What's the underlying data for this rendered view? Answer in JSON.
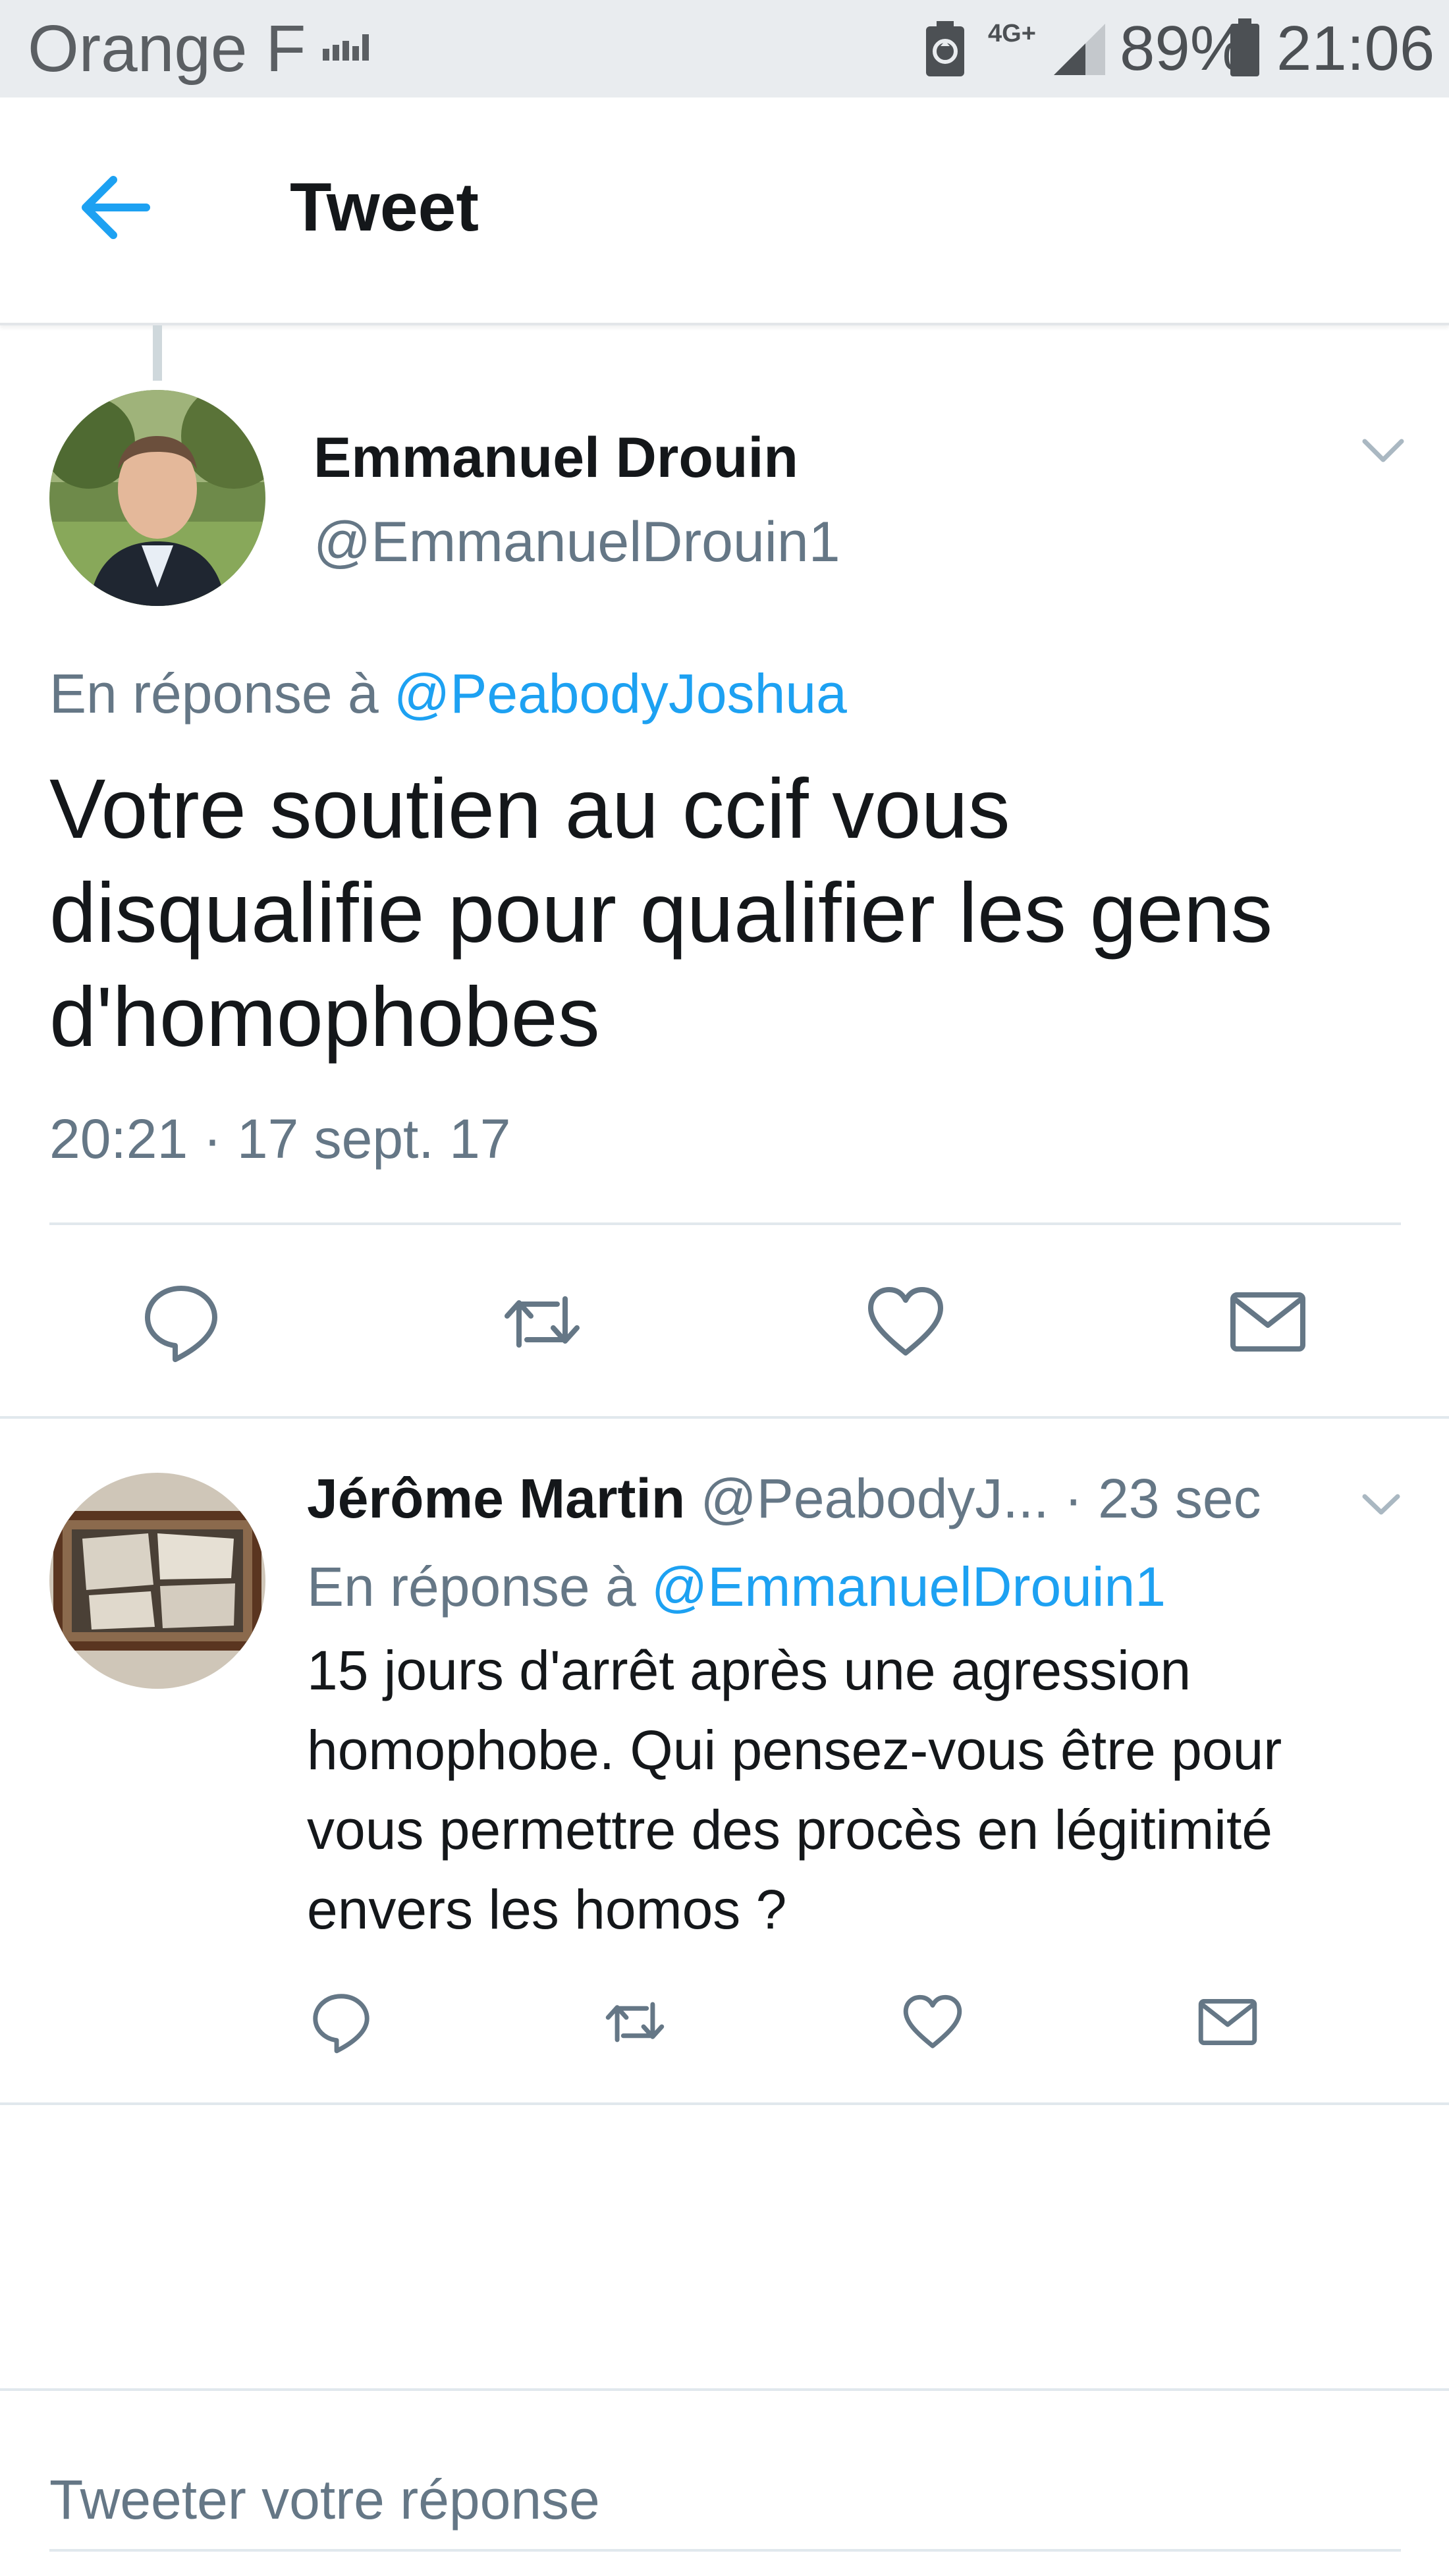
{
  "status_bar": {
    "carrier": "Orange F",
    "network_type": "4G+",
    "battery_percent": "89%",
    "time": "21:06",
    "icons": [
      "signal-bars-icon",
      "battery-saver-icon",
      "cell-signal-icon",
      "battery-icon"
    ]
  },
  "header": {
    "back_icon": "arrow-left-icon",
    "title": "Tweet"
  },
  "main_tweet": {
    "author_name": "Emmanuel Drouin",
    "author_handle": "@EmmanuelDrouin1",
    "reply_prefix": "En réponse à",
    "reply_mention": "@PeabodyJoshua",
    "text": "Votre soutien au ccif vous disqualifie pour qualifier les gens d'homophobes",
    "timestamp": "20:21 · 17 sept. 17",
    "actions": [
      "reply-icon",
      "retweet-icon",
      "like-icon",
      "message-icon"
    ]
  },
  "reply_tweet": {
    "author_name": "Jérôme Martin",
    "author_handle": "@PeabodyJ...",
    "age": "· 23 sec",
    "reply_prefix": "En réponse à",
    "reply_mention": "@EmmanuelDrouin1",
    "text": "15 jours d'arrêt après une agression homophobe. Qui pensez-vous être pour vous permettre des procès en légitimité envers les homos ?",
    "actions": [
      "reply-icon",
      "retweet-icon",
      "like-icon",
      "message-icon"
    ]
  },
  "compose": {
    "placeholder": "Tweeter votre réponse"
  },
  "colors": {
    "accent": "#1da1f2",
    "text_primary": "#14171a",
    "text_secondary": "#657786",
    "icon_gray": "#657786",
    "status_bar_bg": "#e9ecef"
  }
}
